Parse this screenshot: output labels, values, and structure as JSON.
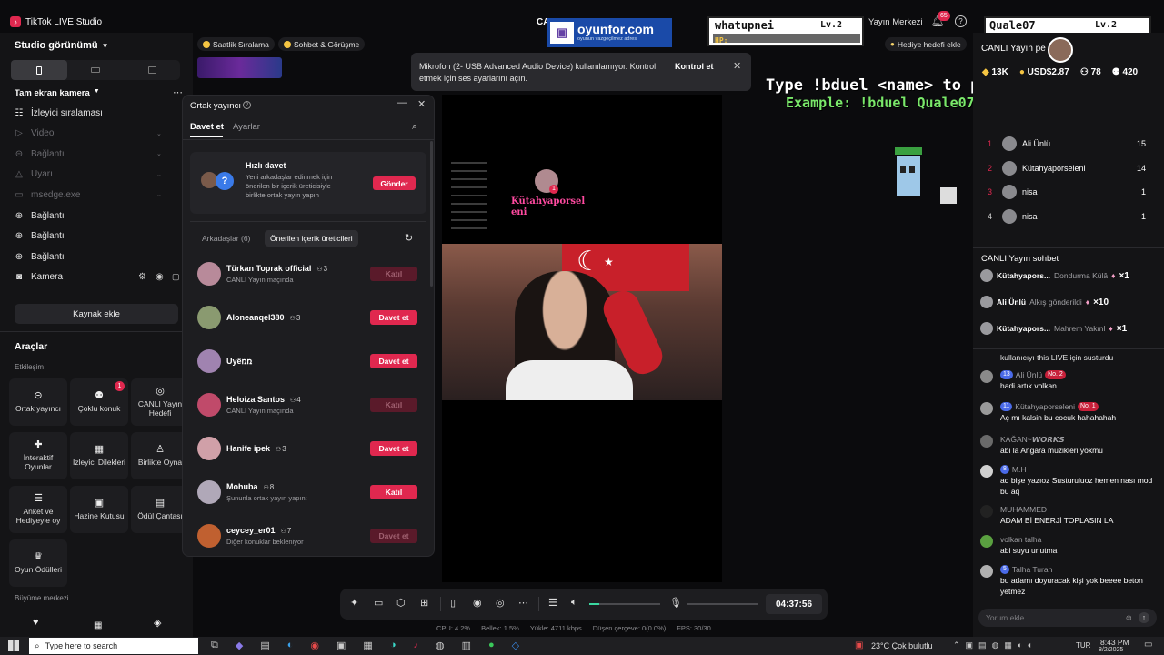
{
  "app": {
    "title": "TikTok LIVE Studio",
    "center_title": "CA",
    "yayin_merkezi": "Yayın Merkezi",
    "notif_count": "65"
  },
  "left": {
    "studio_view": "Studio görünümü",
    "scene_title": "Tam ekran kamera",
    "sources": [
      {
        "label": "İzleyici sıralaması",
        "dim": false,
        "icon": "list-icon"
      },
      {
        "label": "Video",
        "dim": true,
        "icon": "video-icon"
      },
      {
        "label": "Bağlantı",
        "dim": true,
        "icon": "link-icon"
      },
      {
        "label": "Uyarı",
        "dim": true,
        "icon": "alert-icon"
      },
      {
        "label": "msedge.exe",
        "dim": true,
        "icon": "window-icon"
      },
      {
        "label": "Bağlantı",
        "dim": false,
        "icon": "globe-icon"
      },
      {
        "label": "Bağlantı",
        "dim": false,
        "icon": "globe-icon"
      },
      {
        "label": "Bağlantı",
        "dim": false,
        "icon": "globe-icon"
      },
      {
        "label": "Kamera",
        "dim": false,
        "icon": "camera-icon"
      }
    ],
    "add_source": "Kaynak ekle",
    "tools_title": "Araçlar",
    "etkilesim": "Etkileşim",
    "tools": [
      {
        "label": "Ortak yayıncı",
        "icon": "link-icon",
        "badge": ""
      },
      {
        "label": "Çoklu konuk",
        "icon": "users-icon",
        "badge": "1"
      },
      {
        "label": "CANLI Yayın Hedefi",
        "icon": "target-icon",
        "badge": ""
      },
      {
        "label": "İnteraktif Oyunlar",
        "icon": "gamepad-icon",
        "badge": ""
      },
      {
        "label": "İzleyici Dilekleri",
        "icon": "gift-icon",
        "badge": ""
      },
      {
        "label": "Birlikte Oyna",
        "icon": "play-together-icon",
        "badge": ""
      },
      {
        "label": "Anket ve Hediyeyle oy",
        "icon": "poll-icon",
        "badge": ""
      },
      {
        "label": "Hazine Kutusu",
        "icon": "treasure-icon",
        "badge": ""
      },
      {
        "label": "Ödül Çantası",
        "icon": "bag-icon",
        "badge": ""
      },
      {
        "label": "Oyun Ödülleri",
        "icon": "trophy-icon",
        "badge": ""
      }
    ],
    "buyume": "Büyüme merkezi"
  },
  "topchips": {
    "chip1": "Saatlik Sıralama",
    "chip2": "Sohbet & Görüşme",
    "gift_goal": "Hediye hedefi ekle"
  },
  "notice": {
    "text": "Mikrofon (2- USB Advanced Audio Device) kullanılamıyor. Kontrol etmek için ses ayarlarını açın.",
    "action": "Kontrol et"
  },
  "cohost": {
    "title": "Ortak yayıncı",
    "tab_invite": "Davet et",
    "tab_settings": "Ayarlar",
    "quick_title": "Hızlı davet",
    "quick_desc": "Yeni arkadaşlar edinmek için önerilen bir içerik üreticisiyle birlikte ortak yayın yapın",
    "quick_btn": "Gönder",
    "tab_friends": "Arkadaşlar (6)",
    "tab_suggested": "Önerilen içerik üreticileri",
    "users": [
      {
        "name": "Türkan Toprak official",
        "count": "3",
        "sub": "CANLI Yayın maçında",
        "btn": "Katıl",
        "disabled": true,
        "color": "#b88a9a"
      },
      {
        "name": "Aloneanqel380",
        "count": "3",
        "sub": "",
        "btn": "Davet et",
        "disabled": false,
        "color": "#8a9a70"
      },
      {
        "name": "Uyêռռ",
        "count": "",
        "sub": "",
        "btn": "Davet et",
        "disabled": false,
        "color": "#a083b0"
      },
      {
        "name": "Heloiza Santos",
        "count": "4",
        "sub": "CANLI Yayın maçında",
        "btn": "Katıl",
        "disabled": true,
        "color": "#c04a6a"
      },
      {
        "name": "Hanife ipek",
        "count": "3",
        "sub": "",
        "btn": "Davet et",
        "disabled": false,
        "color": "#d0a0a8"
      },
      {
        "name": "Mohuba",
        "count": "8",
        "sub": "Şununla ortak yayın yapın:",
        "btn": "Katıl",
        "disabled": false,
        "color": "#b0a8b8"
      },
      {
        "name": "ceycey_er01",
        "count": "7",
        "sub": "Diğer konuklar bekleniyor",
        "btn": "Davet et",
        "disabled": true,
        "color": "#c06030"
      }
    ]
  },
  "overlay": {
    "brand": "oyunfor.com",
    "brand_sub": "oyunun vazgeçilmez adresi",
    "hp1_name": "whatupnei",
    "hp1_lv": "Lv.2",
    "hp_label": "HP:",
    "hp2_name": "Quale07",
    "hp2_lv": "Lv.2",
    "type_line": "Type !bduel <name> to play",
    "example_line": "Example: !bduel Quale07",
    "stream_user": "Kütahyaporsel eni",
    "stream_badge": "1"
  },
  "stats": {
    "header": "CANLI Yayın pe",
    "likes": "13K",
    "usd": "USD$2.87",
    "viewers": "78",
    "total": "420"
  },
  "ranking": [
    {
      "rank": "1",
      "name": "Ali Ünlü",
      "score": "15",
      "color": "#e0284f"
    },
    {
      "rank": "2",
      "name": "Kütahyaporseleni",
      "score": "14",
      "color": "#e0284f"
    },
    {
      "rank": "3",
      "name": "nisa",
      "score": "1",
      "color": "#e0284f"
    },
    {
      "rank": "4",
      "name": "nisa",
      "score": "1",
      "color": "#cfcfcf"
    }
  ],
  "livechat": {
    "title": "CANLI Yayın sohbet",
    "gifts": [
      {
        "name": "Kütahyapors...",
        "text": "Dondurma Külâ",
        "count": "×1"
      },
      {
        "name": "Ali Ünlü",
        "text": "Alkış gönderildi",
        "count": "×10"
      },
      {
        "name": "Kütahyapors...",
        "text": "Mahrem Yakınl",
        "count": "×1"
      }
    ],
    "first_line": "kullanıcıyı this LIVE için susturdu",
    "messages": [
      {
        "user": "Ali Ünlü",
        "level": "13",
        "rank": "No. 2",
        "text": "hadi artık volkan",
        "color": "#8a8a8a"
      },
      {
        "user": "Kütahyaporseleni",
        "level": "11",
        "rank": "No. 1",
        "text": "Aç mı kalsin bu cocuk hahahahah",
        "color": "#9a9a9a"
      },
      {
        "user": "KAĞAN~𝙒𝙊𝙍𝙆𝙎",
        "level": "",
        "rank": "",
        "text": "abi la Angara müzikleri yokmu",
        "color": "#6a6a6a"
      },
      {
        "user": "M.H",
        "level": "8",
        "rank": "",
        "text": "aq bişe yazıoz Susturuluoz hemen nası mod bu aq",
        "color": "#d0d0d0"
      },
      {
        "user": "MUHAMMED",
        "level": "",
        "rank": "",
        "text": "ADAM Bİ ENERJİ TOPLASIN LA",
        "color": "#222"
      },
      {
        "user": "volkan talha",
        "level": "",
        "rank": "",
        "text": "abi suyu unutma",
        "color": "#5aa040"
      },
      {
        "user": "Talha Turan",
        "level": "5",
        "rank": "",
        "text": "bu adamı doyuracak kişi yok beeee beton yetmez",
        "color": "#b0b0b0"
      }
    ],
    "placeholder": "Yorum ekle"
  },
  "toolbar": {
    "timer": "04:37:56"
  },
  "statusbar": {
    "cpu": "CPU: 4.2%",
    "mem": "Bellek: 1.5%",
    "upload": "Yükle: 4711 kbps",
    "dropped": "Düşen çerçeve: 0(0.0%)",
    "fps": "FPS: 30/30"
  },
  "taskbar": {
    "search": "Type here to search",
    "weather": "23°C  Çok bulutlu",
    "lang": "TUR",
    "time": "8:43 PM",
    "date": "8/2/2025"
  }
}
